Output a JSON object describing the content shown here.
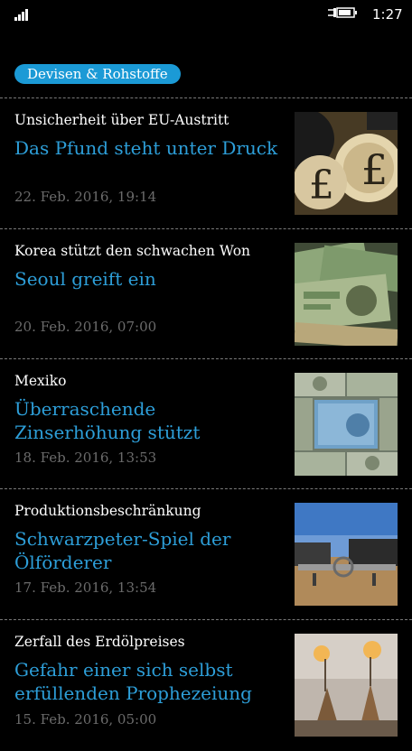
{
  "status_bar": {
    "time": "1:27",
    "signal_icon": "signal-bars-icon",
    "battery_icon": "battery-charging-icon"
  },
  "category": {
    "label": "Devisen & Rohstoffe",
    "color": "#1b9ad6"
  },
  "accent_color": "#2d9ed8",
  "articles": [
    {
      "kicker": "Unsicherheit über EU-Austritt",
      "headline": "Das Pfund steht unter Druck",
      "date": "22. Feb. 2016, 19:14",
      "image": "pound-mosaic-image"
    },
    {
      "kicker": "Korea stützt den schwachen Won",
      "headline": "Seoul greift ein",
      "date": "20. Feb. 2016, 07:00",
      "image": "banknotes-image"
    },
    {
      "kicker": "Mexiko",
      "headline": "Überraschende Zinserhöhung stützt",
      "date": "18. Feb. 2016, 13:53",
      "image": "peso-dollar-notes-image"
    },
    {
      "kicker": "Produktionsbeschränkung",
      "headline": "Schwarzpeter-Spiel der Ölförderer",
      "date": "17. Feb. 2016, 13:54",
      "image": "oil-field-pipeline-image"
    },
    {
      "kicker": "Zerfall des Erdölpreises",
      "headline": "Gefahr einer sich selbst erfüllenden Prophezeiung",
      "date": "15. Feb. 2016, 05:00",
      "image": "oil-rig-flare-image"
    }
  ]
}
